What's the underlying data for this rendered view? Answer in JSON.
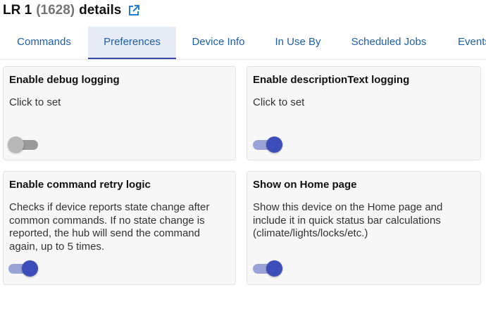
{
  "header": {
    "name": "LR 1",
    "device_id": "(1628)",
    "suffix": "details",
    "external_link_icon": "external-link-icon"
  },
  "tabs": [
    {
      "label": "Commands",
      "active": false
    },
    {
      "label": "Preferences",
      "active": true
    },
    {
      "label": "Device Info",
      "active": false
    },
    {
      "label": "In Use By",
      "active": false
    },
    {
      "label": "Scheduled Jobs",
      "active": false
    },
    {
      "label": "Events",
      "active": false
    }
  ],
  "preferences": [
    {
      "title": "Enable debug logging",
      "description": "Click to set",
      "enabled": false
    },
    {
      "title": "Enable descriptionText logging",
      "description": "Click to set",
      "enabled": true
    },
    {
      "title": "Enable command retry logic",
      "description": "Checks if device reports state change after common commands. If no state change is reported, the hub will send the command again, up to 5 times.",
      "enabled": true
    },
    {
      "title": "Show on Home page",
      "description": "Show this device on the Home page and include it in quick status bar calculations (climate/lights/locks/etc.)",
      "enabled": true
    }
  ],
  "colors": {
    "accent": "#3c4cb8",
    "tab_text": "#1f5fa8",
    "active_tab_bg": "#e7ebf6",
    "card_bg": "#f7f7f7"
  }
}
